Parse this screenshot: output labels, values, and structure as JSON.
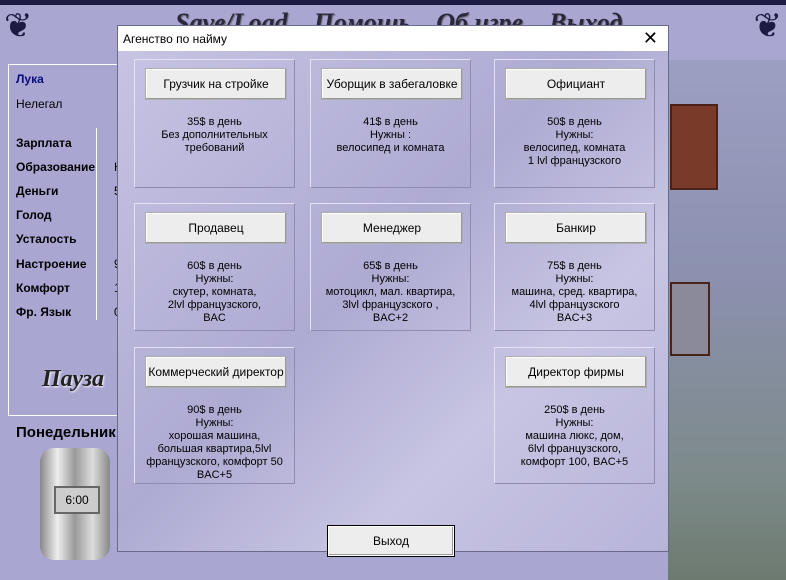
{
  "top_menu": [
    "Save/Load",
    "Помощь",
    "Об игре",
    "Выход"
  ],
  "player": {
    "name": "Лука",
    "status": "Нелегал"
  },
  "stats": [
    {
      "label": "Зарплата",
      "value": ""
    },
    {
      "label": "Образование",
      "value": "Н"
    },
    {
      "label": "Деньги",
      "value": "5"
    },
    {
      "label": "Голод",
      "value": ""
    },
    {
      "label": "Усталость",
      "value": ""
    },
    {
      "label": "Настроение",
      "value": "9"
    },
    {
      "label": "Комфорт",
      "value": "1"
    },
    {
      "label": "Фр. Язык",
      "value": "0"
    }
  ],
  "pause_label": "Пауза",
  "day": "Понедельник",
  "clock": "6:00",
  "dialog": {
    "title": "Агенство по найму",
    "exit_label": "Выход",
    "jobs": [
      {
        "title": "Грузчик на стройке",
        "desc": "35$ в день\nБез дополнительных\nтребований"
      },
      {
        "title": "Уборщик в забегаловке",
        "desc": "41$ в день\nНужны :\nвелосипед и комната"
      },
      {
        "title": "Официант",
        "desc": "50$ в день\nНужны:\nвелосипед, комната\n1 lvl французского"
      },
      {
        "title": "Продавец",
        "desc": "60$ в день\nНужны:\nскутер, комната,\n2lvl французского,\nBAC"
      },
      {
        "title": "Менеджер",
        "desc": "65$  в день\nНужны:\nмотоцикл, мал. квартира,\n3lvl французского ,\nBAC+2"
      },
      {
        "title": "Банкир",
        "desc": "75$  в день\nНужны:\nмашина, сред. квартира,\n4lvl французского\nBAC+3"
      },
      {
        "title": "Коммерческий директор",
        "desc": "90$ в день\nНужны:\nхорошая машина,\nбольшая квартира,5lvl\nфранцузского, комфорт 50\nBAC+5"
      },
      {
        "title": "Директор фирмы",
        "desc": "250$ в день\nНужны:\nмашина люкс, дом,\n6lvl французского,\nкомфорт 100, BAC+5"
      }
    ]
  }
}
